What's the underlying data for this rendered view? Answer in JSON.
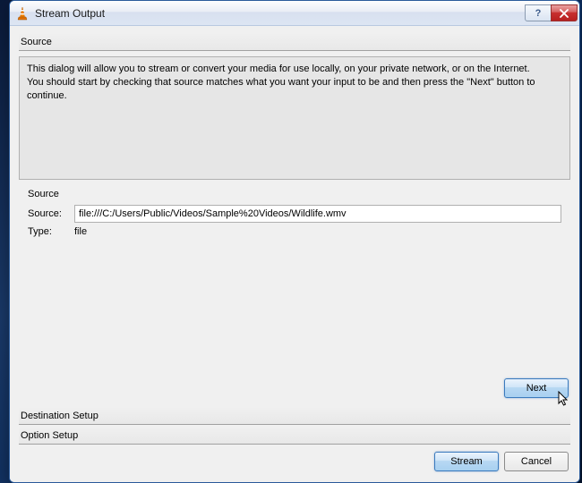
{
  "window": {
    "title": "Stream Output"
  },
  "sections": {
    "source": "Source",
    "destination": "Destination Setup",
    "option": "Option Setup"
  },
  "description": "This dialog will allow you to stream or convert your media for use locally, on your private network, or on the Internet.\nYou should start by checking that source matches what you want your input to be and then press the \"Next\" button to continue.",
  "source_group": {
    "label": "Source",
    "source_label": "Source:",
    "source_value": "file:///C:/Users/Public/Videos/Sample%20Videos/Wildlife.wmv",
    "type_label": "Type:",
    "type_value": "file"
  },
  "buttons": {
    "next": "Next",
    "stream": "Stream",
    "cancel": "Cancel"
  }
}
